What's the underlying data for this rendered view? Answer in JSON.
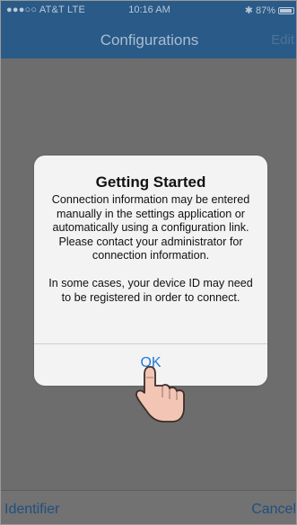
{
  "status_bar": {
    "carrier": "●●●○○ AT&T  LTE",
    "time": "10:16 AM",
    "battery": "87%",
    "bluetooth_icon": "bluetooth-icon",
    "battery_icon": "battery-icon"
  },
  "nav": {
    "title": "Configurations",
    "edit_label": "Edit"
  },
  "alert": {
    "title": "Getting Started",
    "message_1": "Connection information may be entered manually in the settings application or automatically using a configuration link. Please contact your administrator for connection information.",
    "message_2": "In some cases, your device ID may need to be registered in order to connect.",
    "ok_label": "OK"
  },
  "toolbar": {
    "left_label": "Identifier",
    "right_label": "Cancel"
  },
  "colors": {
    "nav_bg": "#2a5a87",
    "accent": "#1e7ad9"
  }
}
